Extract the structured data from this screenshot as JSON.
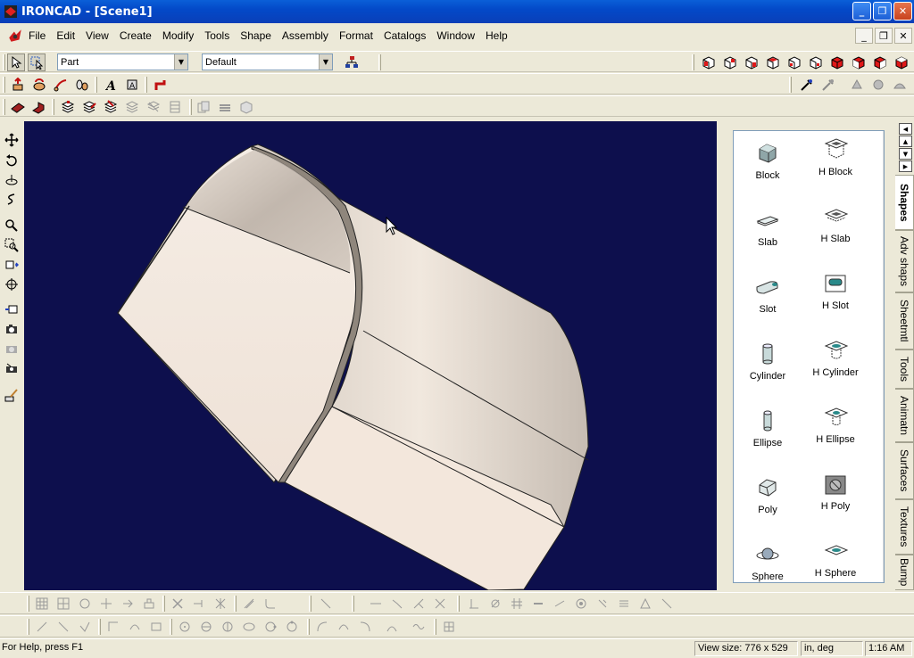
{
  "window": {
    "title": "IRONCAD - [Scene1]"
  },
  "menu": [
    "File",
    "Edit",
    "View",
    "Create",
    "Modify",
    "Tools",
    "Shape",
    "Assembly",
    "Format",
    "Catalogs",
    "Window",
    "Help"
  ],
  "toolbar": {
    "mode_combo": "Part",
    "style_combo": "Default"
  },
  "catalog": {
    "items": [
      {
        "label": "Block",
        "icon": "block-icon"
      },
      {
        "label": "H Block",
        "icon": "h-block-icon"
      },
      {
        "label": "Slab",
        "icon": "slab-icon"
      },
      {
        "label": "H Slab",
        "icon": "h-slab-icon"
      },
      {
        "label": "Slot",
        "icon": "slot-icon"
      },
      {
        "label": "H Slot",
        "icon": "h-slot-icon"
      },
      {
        "label": "Cylinder",
        "icon": "cylinder-icon"
      },
      {
        "label": "H Cylinder",
        "icon": "h-cylinder-icon"
      },
      {
        "label": "Ellipse",
        "icon": "ellipse-icon"
      },
      {
        "label": "H Ellipse",
        "icon": "h-ellipse-icon"
      },
      {
        "label": "Poly",
        "icon": "poly-icon"
      },
      {
        "label": "H Poly",
        "icon": "h-poly-icon"
      },
      {
        "label": "Sphere",
        "icon": "sphere-icon"
      },
      {
        "label": "H Sphere",
        "icon": "h-sphere-icon"
      }
    ],
    "tabs": [
      "Shapes",
      "Adv shaps",
      "Sheetmtl",
      "Tools",
      "Animatn",
      "Surfaces",
      "Textures",
      "Bump"
    ],
    "active_tab": "Shapes"
  },
  "status": {
    "help_text": "For Help, press F1",
    "view_size": "View size:  776 x  529",
    "units": "in, deg",
    "time": "1:16 AM"
  },
  "colors": {
    "viewport_bg": "#0d0f4d",
    "part_surface": "#d8cfc6",
    "title_bar": "#0349c8"
  }
}
